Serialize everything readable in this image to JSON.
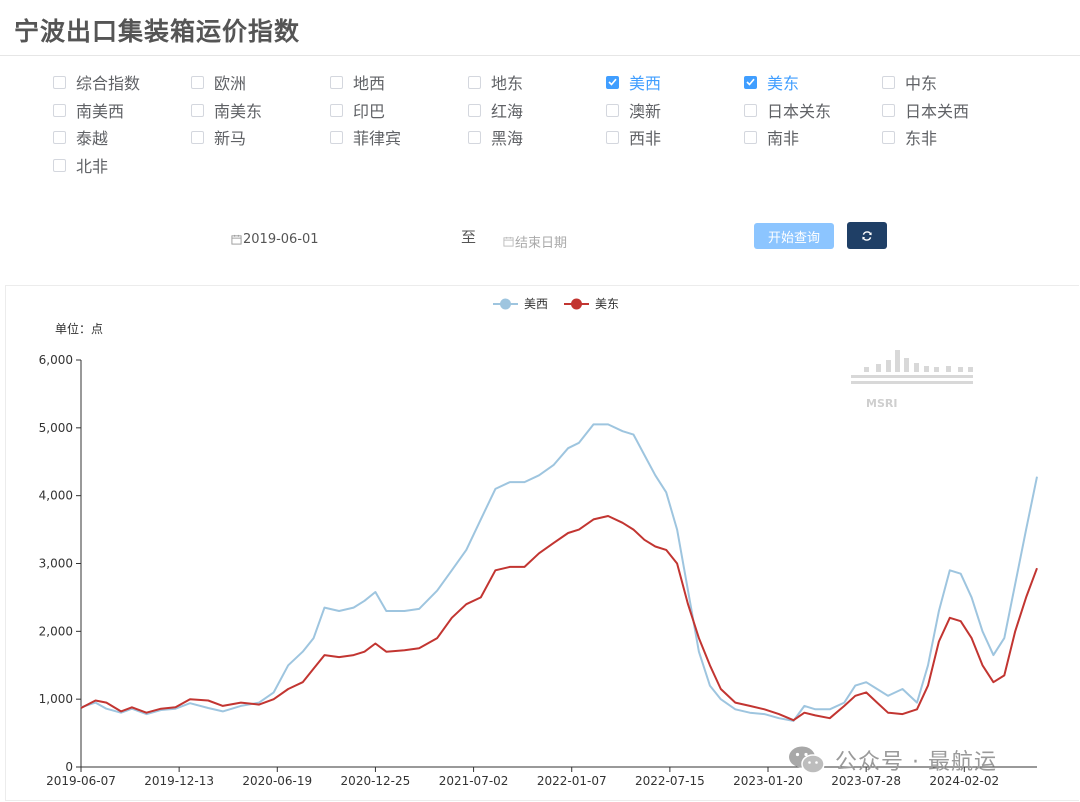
{
  "page": {
    "title": "宁波出口集装箱运价指数"
  },
  "filters": {
    "items": [
      {
        "label": "综合指数",
        "checked": false
      },
      {
        "label": "欧洲",
        "checked": false
      },
      {
        "label": "地西",
        "checked": false
      },
      {
        "label": "地东",
        "checked": false
      },
      {
        "label": "美西",
        "checked": true
      },
      {
        "label": "美东",
        "checked": true
      },
      {
        "label": "中东",
        "checked": false
      },
      {
        "label": "南美西",
        "checked": false
      },
      {
        "label": "南美东",
        "checked": false
      },
      {
        "label": "印巴",
        "checked": false
      },
      {
        "label": "红海",
        "checked": false
      },
      {
        "label": "澳新",
        "checked": false
      },
      {
        "label": "日本关东",
        "checked": false
      },
      {
        "label": "日本关西",
        "checked": false
      },
      {
        "label": "泰越",
        "checked": false
      },
      {
        "label": "新马",
        "checked": false
      },
      {
        "label": "菲律宾",
        "checked": false
      },
      {
        "label": "黑海",
        "checked": false
      },
      {
        "label": "西非",
        "checked": false
      },
      {
        "label": "南非",
        "checked": false
      },
      {
        "label": "东非",
        "checked": false
      },
      {
        "label": "北非",
        "checked": false
      }
    ]
  },
  "date_range": {
    "start_value": "2019-06-01",
    "separator": "至",
    "end_placeholder": "结束日期"
  },
  "buttons": {
    "query_label": "开始查询",
    "refresh_icon": "refresh-icon"
  },
  "watermark": {
    "wechat_text": "公众号 · 最航运",
    "logo_text": "MSRI"
  },
  "colors": {
    "us_west": "#9ec5df",
    "us_east": "#c23531",
    "checked": "#409eff",
    "query_button": "#8cc5ff",
    "refresh_button": "#1f3f66"
  },
  "chart_data": {
    "type": "line",
    "unit_label": "单位：点",
    "ylim": [
      0,
      6000
    ],
    "y_ticks": [
      "0",
      "1,000",
      "2,000",
      "3,000",
      "4,000",
      "5,000",
      "6,000"
    ],
    "x_range": [
      "2019-06-07",
      "2024-06-21"
    ],
    "x_tick_labels": [
      "2019-06-07",
      "2019-12-13",
      "2020-06-19",
      "2020-12-25",
      "2021-07-02",
      "2022-01-07",
      "2022-07-15",
      "2023-01-20",
      "2023-07-28",
      "2024-02-02"
    ],
    "legend_position": "top-center",
    "grid": false,
    "series": [
      {
        "name": "美西",
        "points": [
          [
            "2019-06-07",
            880
          ],
          [
            "2019-07-05",
            950
          ],
          [
            "2019-07-26",
            860
          ],
          [
            "2019-08-23",
            800
          ],
          [
            "2019-09-13",
            860
          ],
          [
            "2019-10-11",
            780
          ],
          [
            "2019-11-08",
            840
          ],
          [
            "2019-12-06",
            860
          ],
          [
            "2020-01-03",
            940
          ],
          [
            "2020-02-07",
            870
          ],
          [
            "2020-03-06",
            820
          ],
          [
            "2020-04-10",
            900
          ],
          [
            "2020-05-15",
            950
          ],
          [
            "2020-06-12",
            1100
          ],
          [
            "2020-07-10",
            1500
          ],
          [
            "2020-08-07",
            1700
          ],
          [
            "2020-08-28",
            1900
          ],
          [
            "2020-09-18",
            2350
          ],
          [
            "2020-10-16",
            2300
          ],
          [
            "2020-11-13",
            2350
          ],
          [
            "2020-12-04",
            2450
          ],
          [
            "2020-12-25",
            2580
          ],
          [
            "2021-01-15",
            2300
          ],
          [
            "2021-02-19",
            2300
          ],
          [
            "2021-03-19",
            2330
          ],
          [
            "2021-04-23",
            2600
          ],
          [
            "2021-05-21",
            2900
          ],
          [
            "2021-06-18",
            3200
          ],
          [
            "2021-07-16",
            3650
          ],
          [
            "2021-08-13",
            4100
          ],
          [
            "2021-09-10",
            4200
          ],
          [
            "2021-10-08",
            4200
          ],
          [
            "2021-11-05",
            4300
          ],
          [
            "2021-12-03",
            4450
          ],
          [
            "2021-12-31",
            4700
          ],
          [
            "2022-01-21",
            4780
          ],
          [
            "2022-02-18",
            5050
          ],
          [
            "2022-03-18",
            5050
          ],
          [
            "2022-04-15",
            4950
          ],
          [
            "2022-05-06",
            4900
          ],
          [
            "2022-05-27",
            4600
          ],
          [
            "2022-06-17",
            4300
          ],
          [
            "2022-07-08",
            4050
          ],
          [
            "2022-07-29",
            3500
          ],
          [
            "2022-08-19",
            2600
          ],
          [
            "2022-09-09",
            1700
          ],
          [
            "2022-09-30",
            1200
          ],
          [
            "2022-10-21",
            1000
          ],
          [
            "2022-11-18",
            850
          ],
          [
            "2022-12-16",
            800
          ],
          [
            "2023-01-13",
            780
          ],
          [
            "2023-02-10",
            720
          ],
          [
            "2023-03-10",
            680
          ],
          [
            "2023-03-31",
            900
          ],
          [
            "2023-04-21",
            850
          ],
          [
            "2023-05-19",
            850
          ],
          [
            "2023-06-16",
            950
          ],
          [
            "2023-07-07",
            1200
          ],
          [
            "2023-07-28",
            1250
          ],
          [
            "2023-08-18",
            1150
          ],
          [
            "2023-09-08",
            1050
          ],
          [
            "2023-10-06",
            1150
          ],
          [
            "2023-11-03",
            950
          ],
          [
            "2023-11-24",
            1500
          ],
          [
            "2023-12-15",
            2300
          ],
          [
            "2024-01-05",
            2900
          ],
          [
            "2024-01-26",
            2850
          ],
          [
            "2024-02-16",
            2500
          ],
          [
            "2024-03-08",
            2000
          ],
          [
            "2024-03-29",
            1650
          ],
          [
            "2024-04-19",
            1900
          ],
          [
            "2024-05-10",
            2700
          ],
          [
            "2024-05-31",
            3500
          ],
          [
            "2024-06-21",
            4280
          ]
        ]
      },
      {
        "name": "美东",
        "points": [
          [
            "2019-06-07",
            870
          ],
          [
            "2019-07-05",
            980
          ],
          [
            "2019-07-26",
            950
          ],
          [
            "2019-08-23",
            820
          ],
          [
            "2019-09-13",
            880
          ],
          [
            "2019-10-11",
            800
          ],
          [
            "2019-11-08",
            860
          ],
          [
            "2019-12-06",
            880
          ],
          [
            "2020-01-03",
            1000
          ],
          [
            "2020-02-07",
            980
          ],
          [
            "2020-03-06",
            900
          ],
          [
            "2020-04-10",
            950
          ],
          [
            "2020-05-15",
            920
          ],
          [
            "2020-06-12",
            1000
          ],
          [
            "2020-07-10",
            1150
          ],
          [
            "2020-08-07",
            1250
          ],
          [
            "2020-08-28",
            1450
          ],
          [
            "2020-09-18",
            1650
          ],
          [
            "2020-10-16",
            1620
          ],
          [
            "2020-11-13",
            1650
          ],
          [
            "2020-12-04",
            1700
          ],
          [
            "2020-12-25",
            1820
          ],
          [
            "2021-01-15",
            1700
          ],
          [
            "2021-02-19",
            1720
          ],
          [
            "2021-03-19",
            1750
          ],
          [
            "2021-04-23",
            1900
          ],
          [
            "2021-05-21",
            2200
          ],
          [
            "2021-06-18",
            2400
          ],
          [
            "2021-07-16",
            2500
          ],
          [
            "2021-08-13",
            2900
          ],
          [
            "2021-09-10",
            2950
          ],
          [
            "2021-10-08",
            2950
          ],
          [
            "2021-11-05",
            3150
          ],
          [
            "2021-12-03",
            3300
          ],
          [
            "2021-12-31",
            3450
          ],
          [
            "2022-01-21",
            3500
          ],
          [
            "2022-02-18",
            3650
          ],
          [
            "2022-03-18",
            3700
          ],
          [
            "2022-04-15",
            3600
          ],
          [
            "2022-05-06",
            3500
          ],
          [
            "2022-05-27",
            3350
          ],
          [
            "2022-06-17",
            3250
          ],
          [
            "2022-07-08",
            3200
          ],
          [
            "2022-07-29",
            3000
          ],
          [
            "2022-08-19",
            2400
          ],
          [
            "2022-09-09",
            1900
          ],
          [
            "2022-09-30",
            1500
          ],
          [
            "2022-10-21",
            1150
          ],
          [
            "2022-11-18",
            950
          ],
          [
            "2022-12-16",
            900
          ],
          [
            "2023-01-13",
            850
          ],
          [
            "2023-02-10",
            780
          ],
          [
            "2023-03-10",
            690
          ],
          [
            "2023-03-31",
            800
          ],
          [
            "2023-04-21",
            760
          ],
          [
            "2023-05-19",
            720
          ],
          [
            "2023-06-16",
            900
          ],
          [
            "2023-07-07",
            1050
          ],
          [
            "2023-07-28",
            1100
          ],
          [
            "2023-08-18",
            950
          ],
          [
            "2023-09-08",
            800
          ],
          [
            "2023-10-06",
            780
          ],
          [
            "2023-11-03",
            850
          ],
          [
            "2023-11-24",
            1200
          ],
          [
            "2023-12-15",
            1850
          ],
          [
            "2024-01-05",
            2200
          ],
          [
            "2024-01-26",
            2150
          ],
          [
            "2024-02-16",
            1900
          ],
          [
            "2024-03-08",
            1500
          ],
          [
            "2024-03-29",
            1250
          ],
          [
            "2024-04-19",
            1350
          ],
          [
            "2024-05-10",
            2000
          ],
          [
            "2024-05-31",
            2500
          ],
          [
            "2024-06-21",
            2930
          ]
        ]
      }
    ]
  }
}
